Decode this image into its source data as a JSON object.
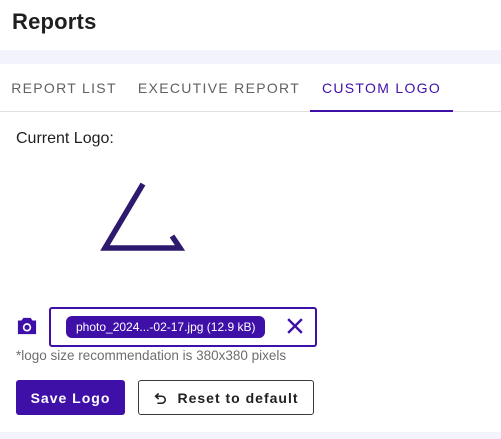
{
  "page": {
    "title": "Reports"
  },
  "tabs": [
    {
      "label": "REPORT LIST",
      "active": false
    },
    {
      "label": "EXECUTIVE REPORT",
      "active": false
    },
    {
      "label": "CUSTOM LOGO",
      "active": true
    }
  ],
  "logo_section": {
    "current_label": "Current Logo:",
    "file_chip": "photo_2024...-02-17.jpg (12.9 kB)",
    "hint": "*logo size recommendation is 380x380 pixels"
  },
  "actions": {
    "save_label": "Save Logo",
    "reset_label": "Reset to default"
  },
  "icons": {
    "camera": "camera-icon",
    "clear": "close-icon",
    "undo": "undo-icon"
  },
  "colors": {
    "accent": "#3f10a8",
    "tab_inactive": "#616161",
    "band": "#f3f4fb"
  }
}
